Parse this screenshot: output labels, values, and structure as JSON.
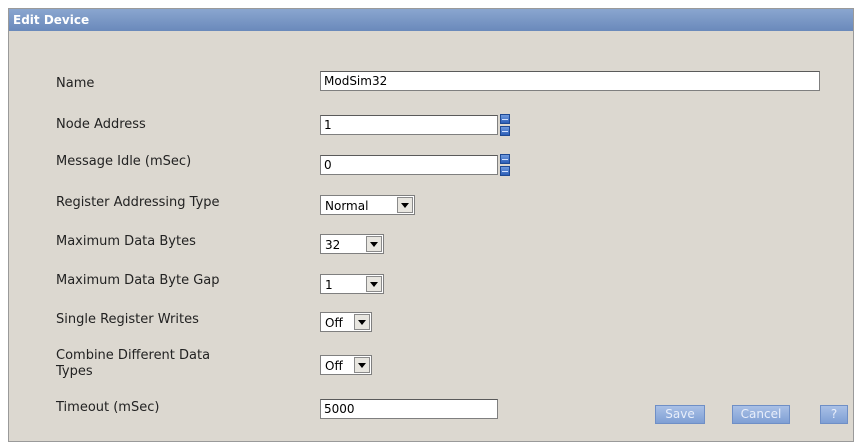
{
  "dialog": {
    "title": "Edit Device"
  },
  "fields": {
    "name": {
      "label": "Name",
      "value": "ModSim32"
    },
    "node_address": {
      "label": "Node Address",
      "value": "1"
    },
    "message_idle": {
      "label": "Message Idle (mSec)",
      "value": "0"
    },
    "register_addressing_type": {
      "label": "Register Addressing Type",
      "value": "Normal"
    },
    "max_data_bytes": {
      "label": "Maximum Data Bytes",
      "value": "32"
    },
    "max_data_byte_gap": {
      "label": "Maximum Data Byte Gap",
      "value": "1"
    },
    "single_register_writes": {
      "label": "Single Register Writes",
      "value": "Off"
    },
    "combine_data_types": {
      "label_line1": "Combine Different Data",
      "label_line2": "Types",
      "value": "Off"
    },
    "timeout": {
      "label": "Timeout (mSec)",
      "value": "5000"
    }
  },
  "buttons": {
    "save": "Save",
    "cancel": "Cancel",
    "help": "?"
  },
  "icons": {
    "spinner": "spinner-icon",
    "dropdown": "chevron-down-icon"
  },
  "colors": {
    "titlebar": "#7896c6",
    "panel": "#dcd8d0",
    "button": "#8fabd9"
  }
}
